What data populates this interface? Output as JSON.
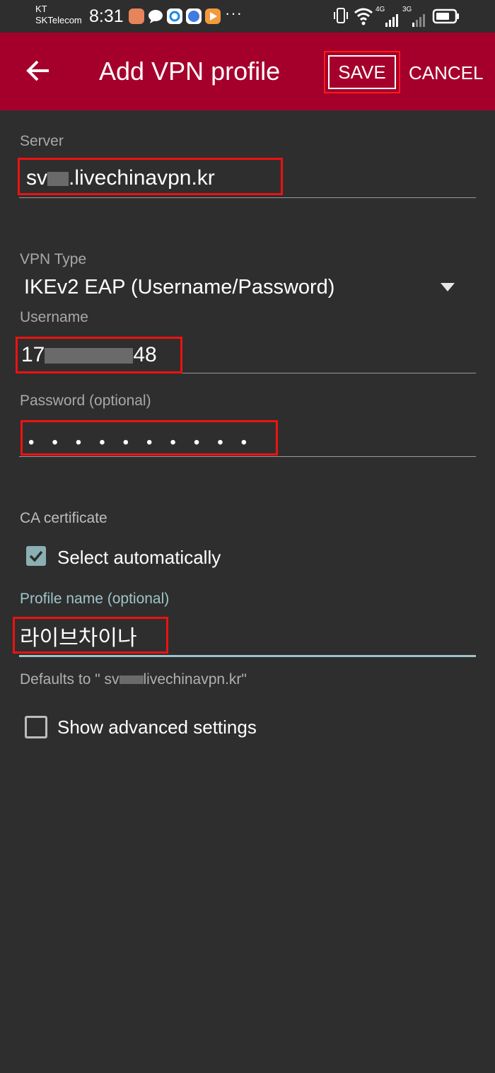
{
  "status_bar": {
    "carrier_top": "KT",
    "carrier_bottom": "SKTelecom",
    "time": "8:31",
    "more": "···",
    "network_1": "4G",
    "network_2": "3G"
  },
  "app_bar": {
    "title": "Add VPN profile",
    "save_label": "SAVE",
    "cancel_label": "CANCEL"
  },
  "form": {
    "server_label": "Server",
    "server_value_prefix": "sv",
    "server_value_suffix": ".livechinavpn.kr",
    "vpn_type_label": "VPN Type",
    "vpn_type_value": "IKEv2 EAP (Username/Password)",
    "username_label": "Username",
    "username_prefix": "17",
    "username_suffix": "48",
    "password_label": "Password (optional)",
    "password_mask": "••••••••••",
    "ca_label": "CA certificate",
    "select_auto_label": "Select automatically",
    "profile_label": "Profile name (optional)",
    "profile_value": "라이브차이나",
    "defaults_prefix": "Defaults to \" sv",
    "defaults_suffix": "livechinavpn.kr\"",
    "advanced_label": "Show advanced settings"
  },
  "colors": {
    "app_bar": "#a5002c",
    "background": "#2e2e2e",
    "accent": "#9fc4c8",
    "highlight": "#ee1111"
  }
}
